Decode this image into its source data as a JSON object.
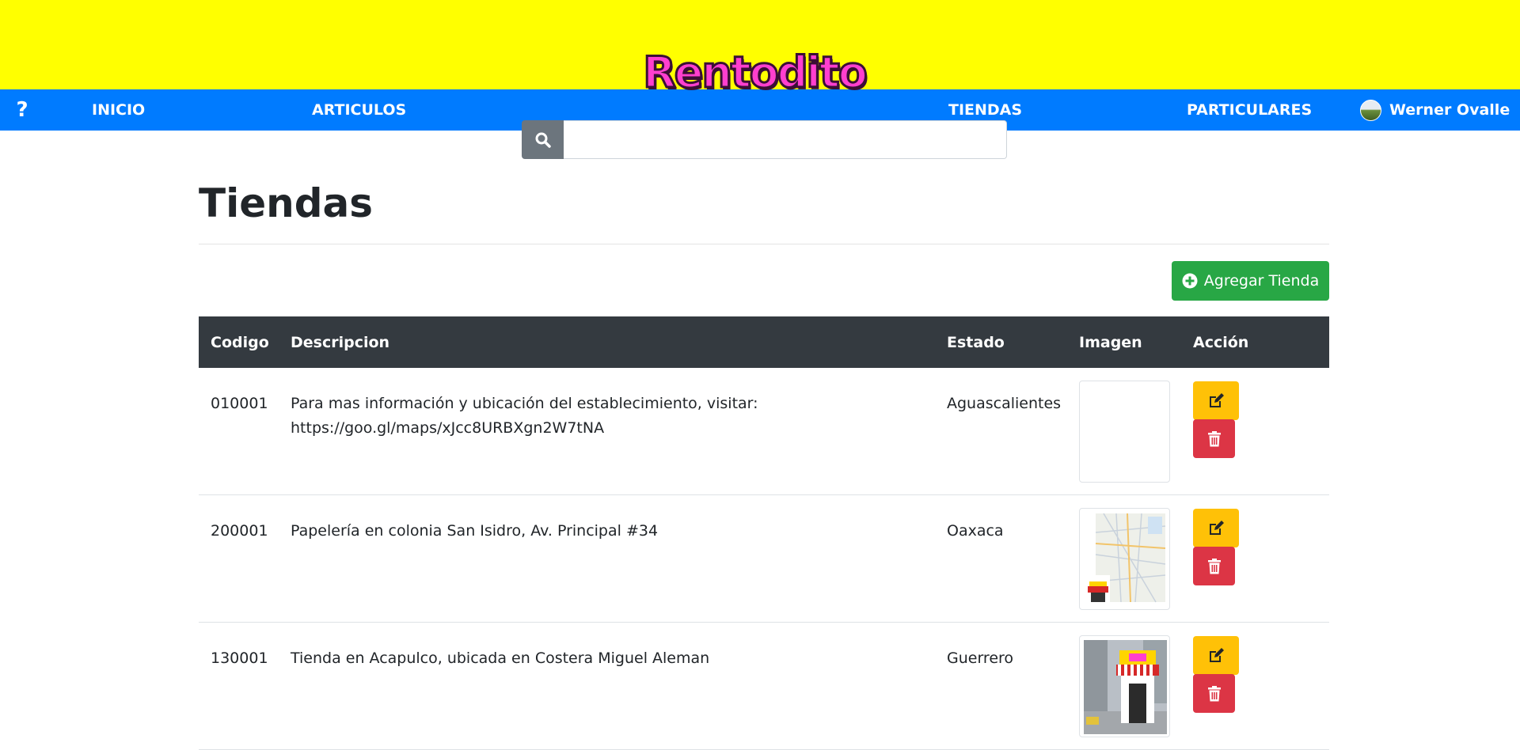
{
  "brand": {
    "logo_text": "Rentodito"
  },
  "nav": {
    "help": "?",
    "inicio": "INICIO",
    "articulos": "ARTICULOS",
    "tiendas": "TIENDAS",
    "particulares": "PARTICULARES",
    "user": "Werner Ovalle"
  },
  "search": {
    "value": "",
    "icon": "search-icon"
  },
  "page": {
    "title": "Tiendas",
    "add_button": "Agregar Tienda"
  },
  "table": {
    "columns": [
      "Codigo",
      "Descripcion",
      "Estado",
      "Imagen",
      "Acción"
    ],
    "rows": [
      {
        "codigo": "010001",
        "descripcion": "Para mas información y ubicación del establecimiento, visitar: https://goo.gl/maps/xJcc8URBXgn2W7tNA",
        "estado": "Aguascalientes",
        "imagen": "empty"
      },
      {
        "codigo": "200001",
        "descripcion": "Papelería en colonia San Isidro, Av. Principal #34",
        "estado": "Oaxaca",
        "imagen": "map-with-store"
      },
      {
        "codigo": "130001",
        "descripcion": "Tienda en Acapulco, ubicada en Costera Miguel Aleman",
        "estado": "Guerrero",
        "imagen": "street-store"
      }
    ]
  },
  "colors": {
    "topbar": "#ffff00",
    "navbar": "#007bff",
    "table_header": "#343a40",
    "add": "#28a745",
    "edit": "#ffc107",
    "delete": "#dc3545",
    "logo": "#ff3fcf"
  }
}
